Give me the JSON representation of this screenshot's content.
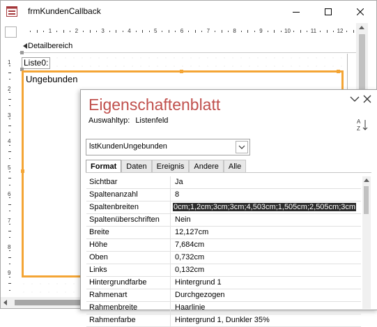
{
  "window": {
    "title": "frmKundenCallback",
    "icon": "form-icon",
    "buttons": [
      "minimize-icon",
      "maximize-icon",
      "close-icon"
    ]
  },
  "ruler": {
    "labels": [
      "1",
      "2",
      "3",
      "4",
      "5",
      "6",
      "7",
      "8",
      "9",
      "10",
      "11",
      "12"
    ]
  },
  "vruler": {
    "labels": [
      "1",
      "2",
      "3",
      "4",
      "5",
      "6",
      "7",
      "8",
      "9"
    ]
  },
  "section": {
    "label": "Detailbereich"
  },
  "design": {
    "label_control": "Liste0:",
    "listbox_text": "Ungebunden",
    "accent": "#f4a535"
  },
  "propsheet": {
    "title": "Eigenschaftenblatt",
    "title_color": "#c0504d",
    "selection_type_label": "Auswahltyp:",
    "selection_type_value": "Listenfeld",
    "combo_value": "lstKundenUngebunden",
    "tabs": [
      "Format",
      "Daten",
      "Ereignis",
      "Andere",
      "Alle"
    ],
    "active_tab": "Format",
    "properties": [
      {
        "name": "Sichtbar",
        "value": "Ja"
      },
      {
        "name": "Spaltenanzahl",
        "value": "8"
      },
      {
        "name": "Spaltenbreiten",
        "value": "0cm;1,2cm;3cm;3cm;4,503cm;1,505cm;2,505cm;3cm"
      },
      {
        "name": "Spaltenüberschriften",
        "value": "Nein"
      },
      {
        "name": "Breite",
        "value": "12,127cm"
      },
      {
        "name": "Höhe",
        "value": "7,684cm"
      },
      {
        "name": "Oben",
        "value": "0,732cm"
      },
      {
        "name": "Links",
        "value": "0,132cm"
      },
      {
        "name": "Hintergrundfarbe",
        "value": "Hintergrund 1"
      },
      {
        "name": "Rahmenart",
        "value": "Durchgezogen"
      },
      {
        "name": "Rahmenbreite",
        "value": "Haarlinie"
      },
      {
        "name": "Rahmenfarbe",
        "value": "Hintergrund 1, Dunkler 35%"
      }
    ],
    "selected_index": 2
  }
}
